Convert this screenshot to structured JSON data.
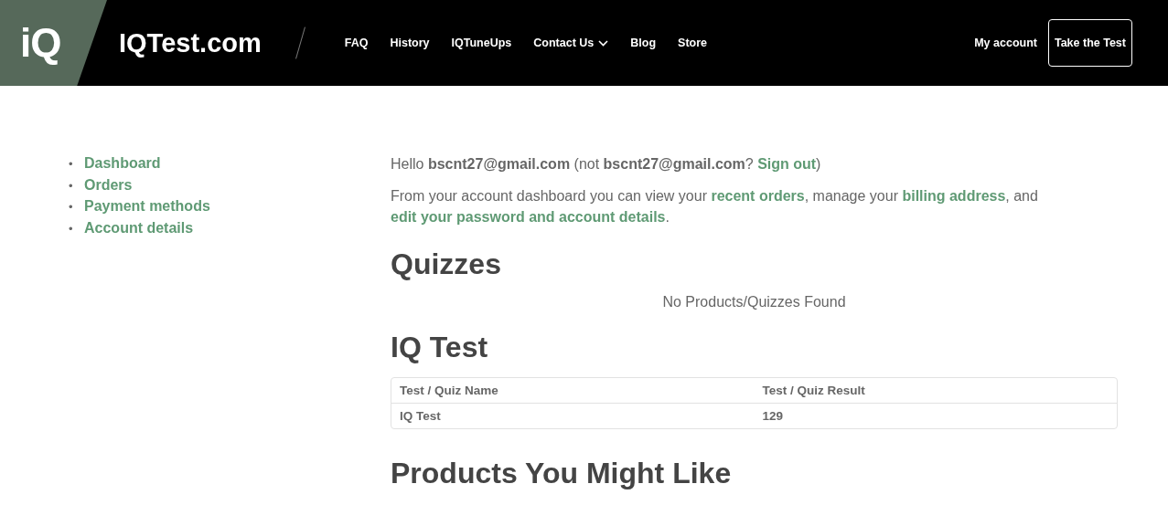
{
  "header": {
    "logo_mark": "iQ",
    "site_name": "IQTest.com",
    "nav": [
      {
        "label": "FAQ",
        "dropdown": false
      },
      {
        "label": "History",
        "dropdown": false
      },
      {
        "label": "IQTuneUps",
        "dropdown": false
      },
      {
        "label": "Contact Us",
        "dropdown": true
      },
      {
        "label": "Blog",
        "dropdown": false
      },
      {
        "label": "Store",
        "dropdown": false
      }
    ],
    "account_link": "My account",
    "cta_button": "Take the Test"
  },
  "sidebar": {
    "items": [
      {
        "marker": "•",
        "label": "Dashboard"
      },
      {
        "marker": "•",
        "label": "Orders"
      },
      {
        "marker": "•",
        "label": "Payment methods"
      },
      {
        "marker": "•",
        "label": "Account details"
      }
    ]
  },
  "greeting": [
    {
      "kind": "text",
      "text": "Hello "
    },
    {
      "kind": "bold",
      "text": "bscnt27@gmail.com"
    },
    {
      "kind": "text",
      "text": " (not "
    },
    {
      "kind": "bold",
      "text": "bscnt27@gmail.com"
    },
    {
      "kind": "text",
      "text": "? "
    },
    {
      "kind": "link",
      "text": "Sign out"
    },
    {
      "kind": "text",
      "text": ")"
    }
  ],
  "intro": [
    {
      "kind": "text",
      "text": "From your account dashboard you can view your "
    },
    {
      "kind": "link",
      "text": "recent orders"
    },
    {
      "kind": "text",
      "text": ", manage your "
    },
    {
      "kind": "link",
      "text": "billing address"
    },
    {
      "kind": "text",
      "text": ", and "
    },
    {
      "kind": "link",
      "text": "edit your "
    },
    {
      "kind": "link",
      "text": "password and account details"
    },
    {
      "kind": "text",
      "text": "."
    }
  ],
  "quizzes": {
    "heading": "Quizzes",
    "empty_message": "No Products/Quizzes Found"
  },
  "iq_test": {
    "heading": "IQ Test",
    "table": {
      "columns": [
        "Test / Quiz Name",
        "Test / Quiz Result"
      ],
      "rows": [
        [
          "IQ Test",
          "129"
        ]
      ]
    }
  },
  "products": {
    "heading": "Products You Might Like"
  }
}
